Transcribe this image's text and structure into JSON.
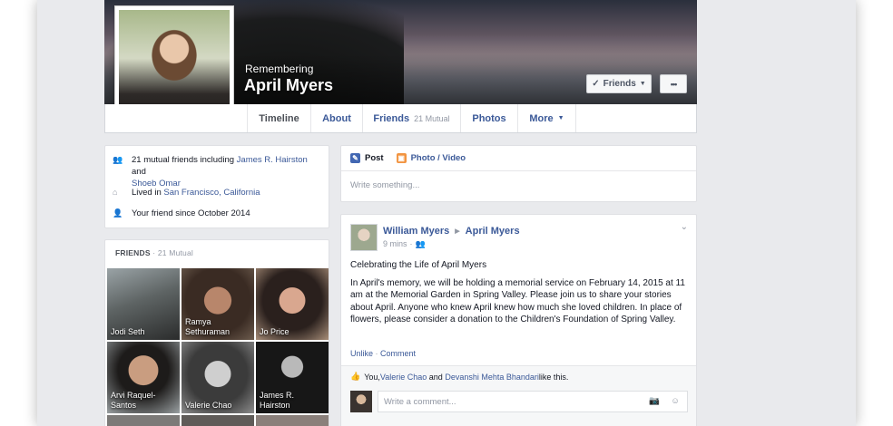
{
  "profile": {
    "remembering": "Remembering",
    "name": "April Myers",
    "friends_button": "Friends",
    "more_button": "•••"
  },
  "tabs": [
    {
      "label": "Timeline"
    },
    {
      "label": "About"
    },
    {
      "label": "Friends",
      "badge": "21 Mutual"
    },
    {
      "label": "Photos"
    },
    {
      "label": "More"
    }
  ],
  "intro": {
    "mutual_prefix": "21 mutual friends including ",
    "mutual_friend_1": "James R. Hairston",
    "mutual_and": " and",
    "mutual_friend_2": "Shoeb Omar",
    "lived_prefix": "Lived in ",
    "lived_place": "San Francisco, California",
    "friend_since": "Your friend since October 2014"
  },
  "friends_box": {
    "title": "FRIENDS",
    "count": " · 21 Mutual",
    "tiles": [
      {
        "name": "Jodi Seth"
      },
      {
        "name": "Ramya Sethuraman"
      },
      {
        "name": "Jo Price"
      },
      {
        "name": "Arvi Raquel-Santos"
      },
      {
        "name": "Valerie Chao"
      },
      {
        "name": "James R. Hairston"
      }
    ]
  },
  "composer": {
    "post_tab": "Post",
    "photo_tab": "Photo / Video",
    "placeholder": "Write something..."
  },
  "post": {
    "author": "William Myers",
    "target": "April Myers",
    "time": "9 mins",
    "title": "Celebrating the Life of April Myers",
    "body": "In April's memory, we will be holding a memorial service on February 14, 2015 at 11 am at the Memorial Garden in Spring Valley. Please join us to share your stories about April. Anyone who knew April knew how much she loved children. In place of flowers, please consider a donation to the Children's Foundation of Spring Valley.",
    "unlike": "Unlike",
    "comment": "Comment",
    "likes_prefix": "You, ",
    "like_person_1": "Valerie Chao",
    "likes_and": " and ",
    "like_person_2": "Devanshi Mehta Bhandari",
    "likes_suffix": " like this.",
    "comment_placeholder": "Write a comment..."
  },
  "colors": {
    "link": "#3b5998",
    "background": "#e9eaed"
  }
}
